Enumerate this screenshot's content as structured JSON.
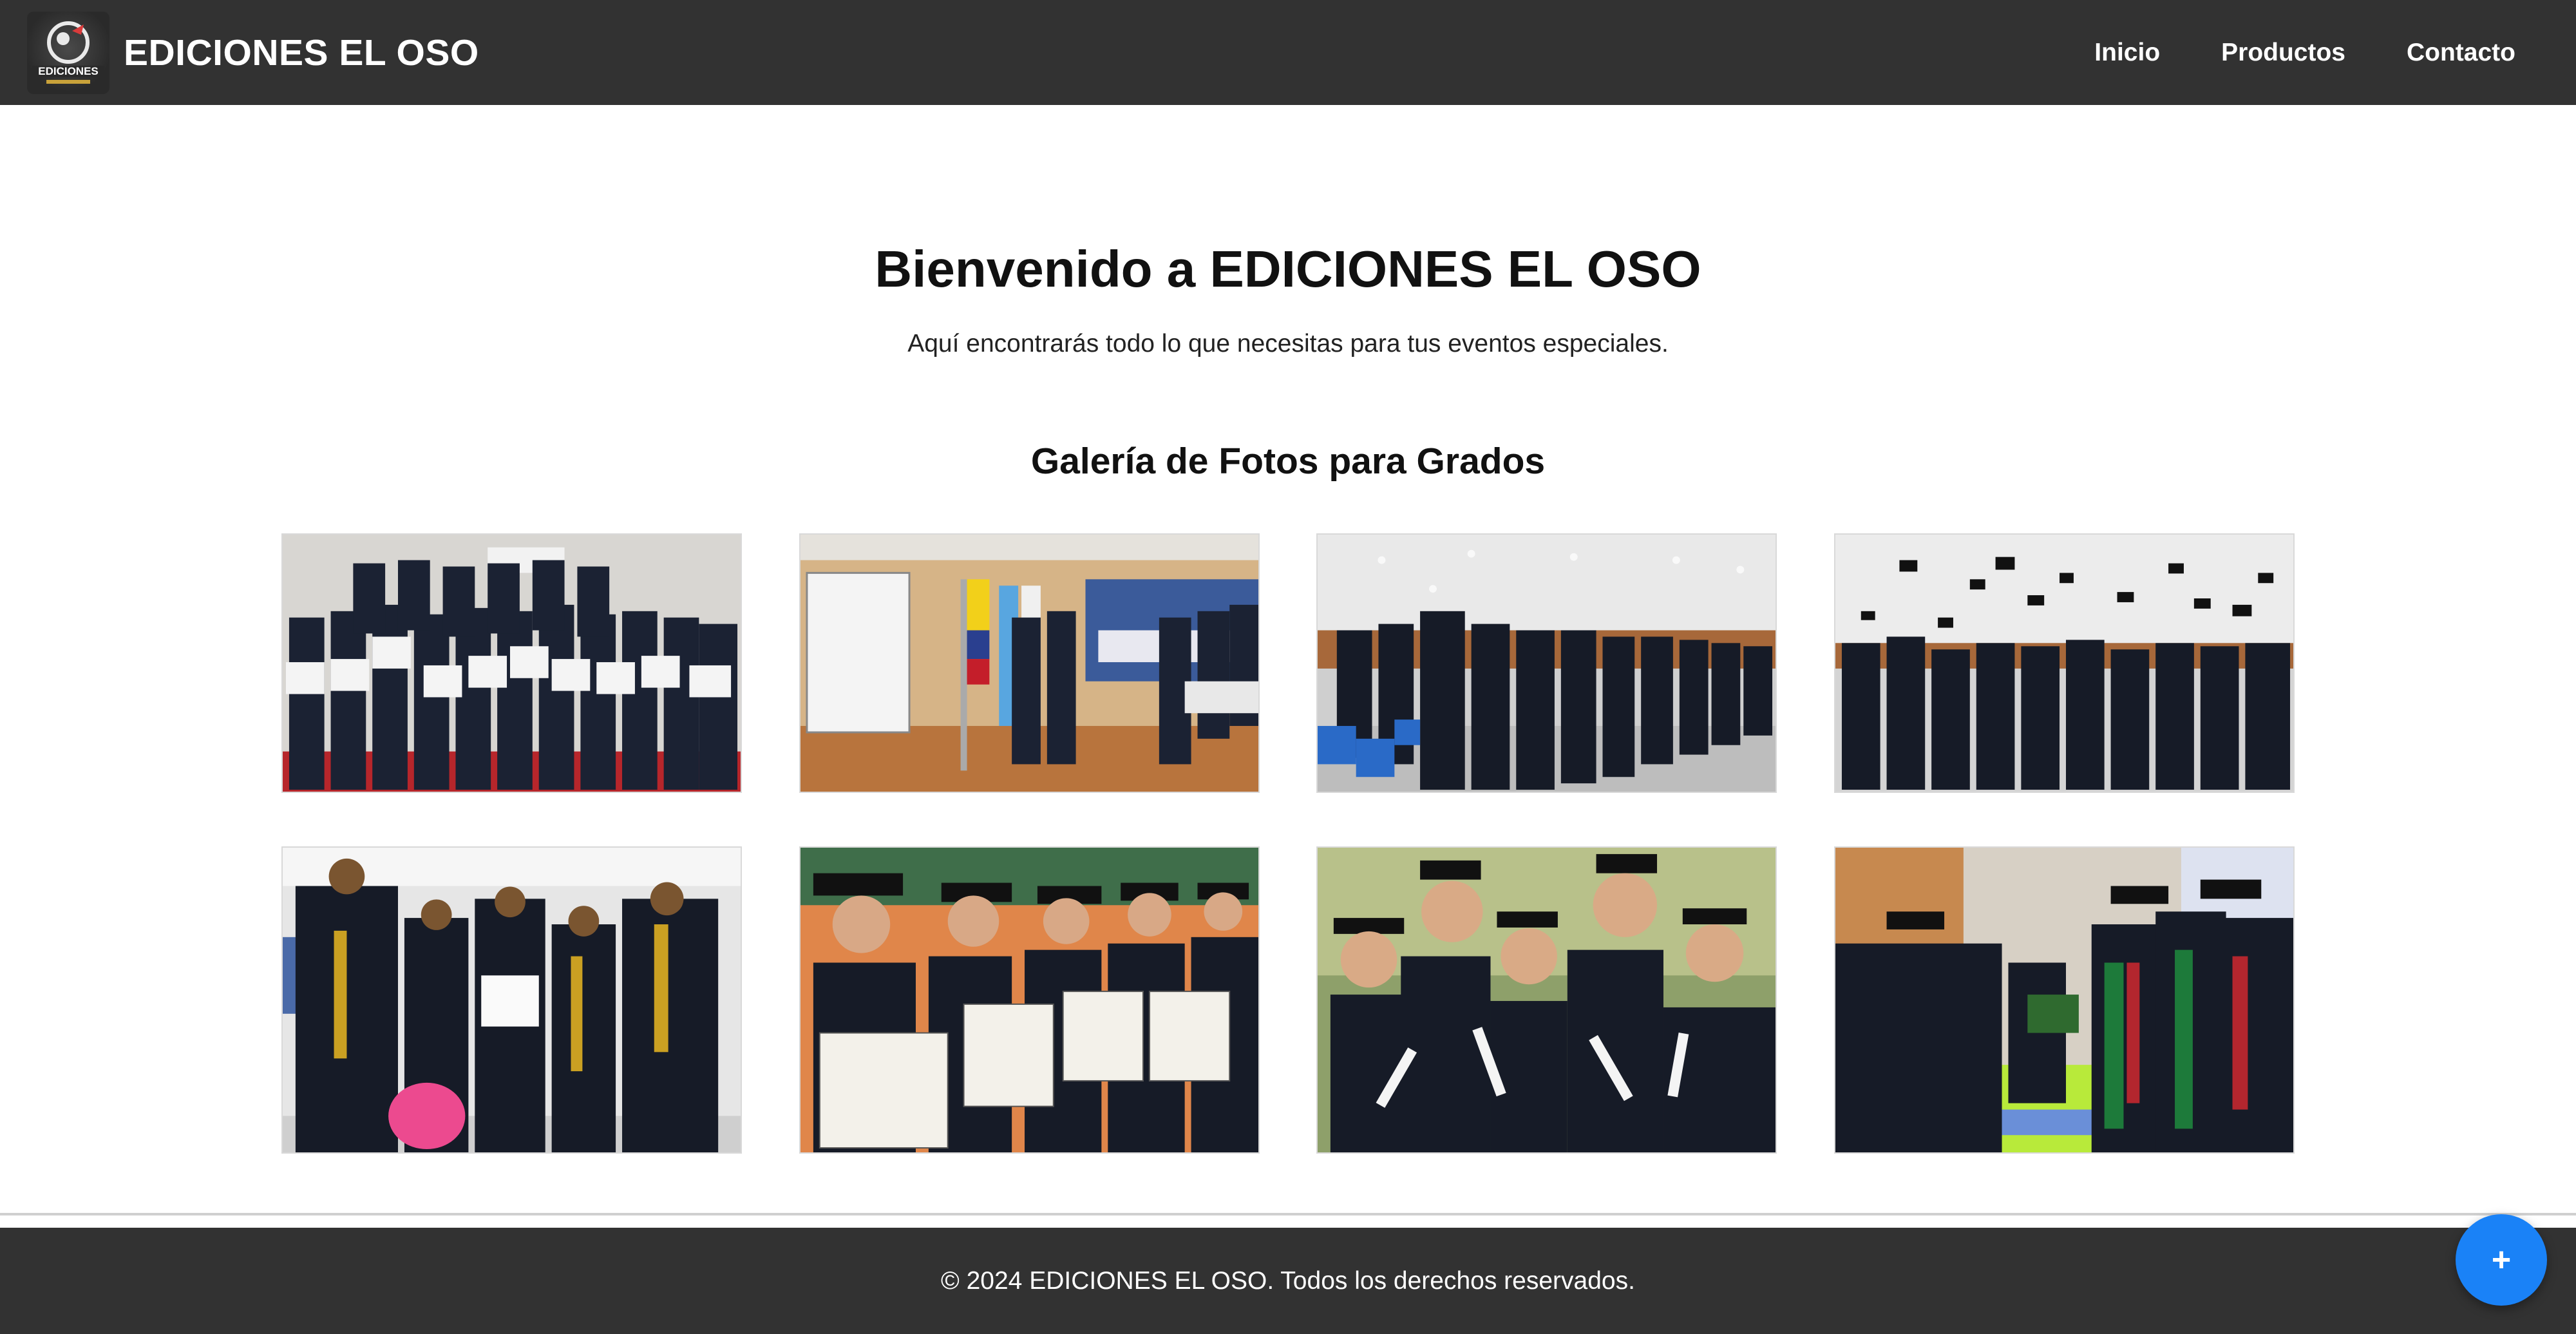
{
  "navbar": {
    "brand_name": "EDICIONES EL OSO",
    "logo_text": "EDICIONES",
    "links": [
      "Inicio",
      "Productos",
      "Contacto"
    ]
  },
  "hero": {
    "title": "Bienvenido a EDICIONES EL OSO",
    "subtitle": "Aquí encontrarás todo lo que necesitas para tus eventos especiales."
  },
  "gallery": {
    "title": "Galería de Fotos para Grados",
    "photos": [
      "graduates-group-with-diplomas-photo",
      "graduation-stage-with-flags-photo",
      "graduates-in-auditorium-photo",
      "caps-thrown-in-air-photo",
      "graduates-group-with-balloon-photo",
      "seated-graduates-with-diplomas-photo",
      "smiling-graduates-outdoors-photo",
      "diploma-handover-ceremony-photo"
    ]
  },
  "footer": {
    "text": "© 2024 EDICIONES EL OSO. Todos los derechos reservados."
  },
  "fab": {
    "label": "+"
  },
  "colors": {
    "navbar_bg": "#323232",
    "footer_bg": "#323232",
    "fab_bg": "#1a82f7",
    "gown_navy": "#1b2233"
  }
}
